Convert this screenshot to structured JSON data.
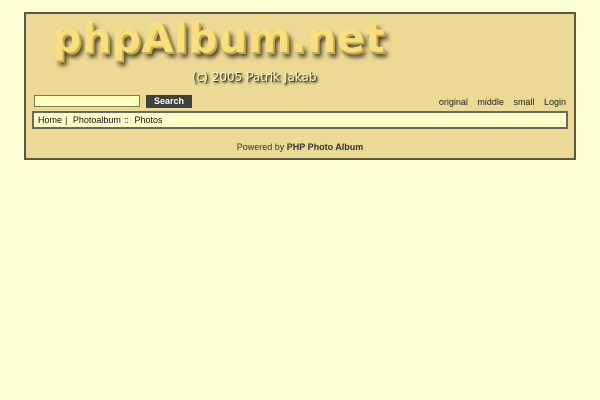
{
  "header": {
    "title": "phpAlbum.net",
    "subtitle": "(c) 2005 Patrik Jakab"
  },
  "search": {
    "value": "",
    "placeholder": "",
    "button_label": "Search"
  },
  "size_nav": {
    "original": "original",
    "middle": "middle",
    "small": "small",
    "login": "Login"
  },
  "breadcrumb": {
    "home": "Home",
    "sep1": "|",
    "photoalbum": "Photoalbum",
    "sep2": "::",
    "photos": "Photos"
  },
  "footer": {
    "prefix": "Powered by",
    "brand": "PHP Photo Album"
  },
  "colors": {
    "page_background": "#ffffd6",
    "panel_background": "#ecd994",
    "logo_text": "#f7e07c",
    "button_background": "#3f3f3f"
  }
}
